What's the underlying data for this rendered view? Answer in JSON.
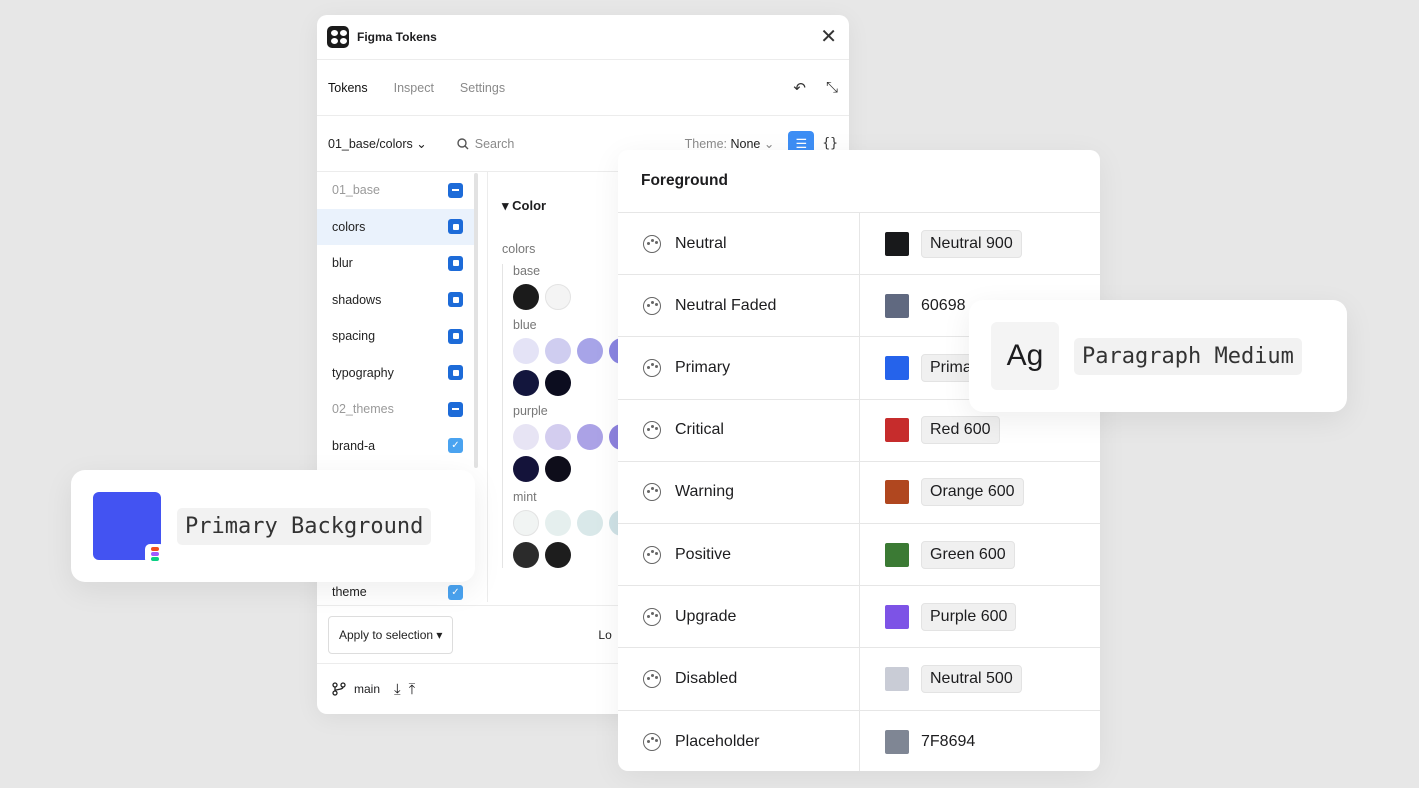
{
  "plugin": {
    "title": "Figma Tokens",
    "close_glyph": "✕",
    "tabs": [
      "Tokens",
      "Inspect",
      "Settings"
    ],
    "undo_glyph": "↶",
    "collapse_glyph": "⤡",
    "set_selector": "01_base/colors",
    "search_placeholder": "Search",
    "theme_label": "Theme:",
    "theme_value": "None",
    "json_glyph": "{}",
    "sets": [
      {
        "label": "01_base",
        "state": "partial"
      },
      {
        "label": "colors",
        "state": "partial-square"
      },
      {
        "label": "blur",
        "state": "partial-square"
      },
      {
        "label": "shadows",
        "state": "partial-square"
      },
      {
        "label": "spacing",
        "state": "partial-square"
      },
      {
        "label": "typography",
        "state": "partial-square"
      },
      {
        "label": "02_themes",
        "state": "partial"
      },
      {
        "label": "brand-a",
        "state": "checked"
      },
      {
        "label": "theme",
        "state": "checked"
      }
    ],
    "token_group": "Color",
    "token_sub": "colors",
    "palettes": [
      {
        "name": "base",
        "rows": [
          [
            "#1b1b1b",
            "#f4f4f4"
          ]
        ]
      },
      {
        "name": "blue",
        "rows": [
          [
            "#e4e3f6",
            "#cfcdf0",
            "#a7a4e8",
            "#8a85e2"
          ],
          [
            "#13163d",
            "#0c0d1f"
          ]
        ]
      },
      {
        "name": "purple",
        "rows": [
          [
            "#e7e4f4",
            "#d3cdef",
            "#aba2e6",
            "#8d82de"
          ],
          [
            "#14133a",
            "#0e0d1a"
          ]
        ]
      },
      {
        "name": "mint",
        "rows": [
          [
            "#f1f4f3",
            "#e5efee",
            "#d9e8e9",
            "#cfe2e6"
          ],
          [
            "#2b2b2b",
            "#1d1d1d"
          ]
        ]
      }
    ],
    "apply_button": "Apply to selection ▾",
    "lo_text": "Lo",
    "branch": "main"
  },
  "foreground": {
    "title": "Foreground",
    "rows": [
      {
        "name": "Neutral",
        "value": "Neutral 900",
        "color": "#18191b",
        "pill": true
      },
      {
        "name": "Neutral Faded",
        "value": "60698",
        "color": "#606980",
        "pill": false
      },
      {
        "name": "Primary",
        "value": "Prima",
        "color": "#2563eb",
        "pill": true
      },
      {
        "name": "Critical",
        "value": "Red 600",
        "color": "#c62c2c",
        "pill": true
      },
      {
        "name": "Warning",
        "value": "Orange 600",
        "color": "#b0471f",
        "pill": true
      },
      {
        "name": "Positive",
        "value": "Green 600",
        "color": "#3b7a34",
        "pill": true
      },
      {
        "name": "Upgrade",
        "value": "Purple 600",
        "color": "#7d53e6",
        "pill": true
      },
      {
        "name": "Disabled",
        "value": "Neutral 500",
        "color": "#c9ccd6",
        "pill": true
      },
      {
        "name": "Placeholder",
        "value": "7F8694",
        "color": "#7f8694",
        "pill": false
      }
    ]
  },
  "typography_card": {
    "sample": "Ag",
    "label": "Paragraph Medium"
  },
  "background_card": {
    "label": "Primary Background",
    "color": "#4353f2"
  }
}
